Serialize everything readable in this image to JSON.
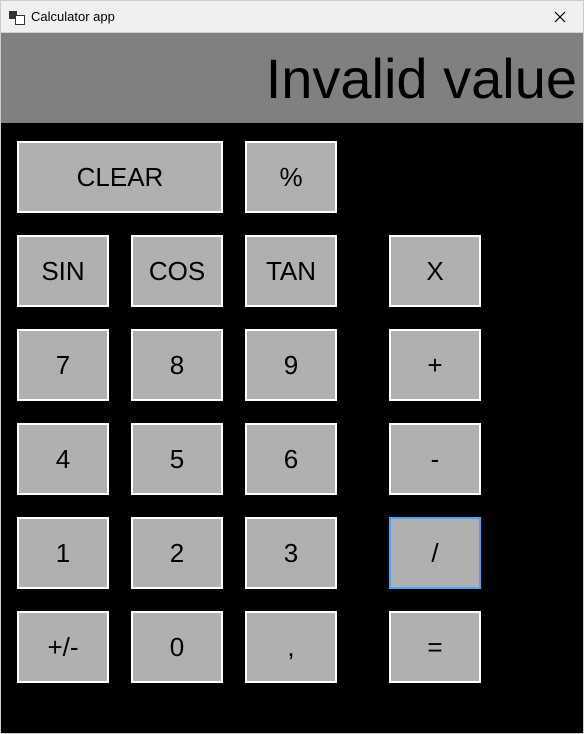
{
  "window": {
    "title": "Calculator app"
  },
  "display": {
    "value": "Invalid value"
  },
  "buttons": {
    "clear": "CLEAR",
    "percent": "%",
    "sin": "SIN",
    "cos": "COS",
    "tan": "TAN",
    "multiply": "X",
    "seven": "7",
    "eight": "8",
    "nine": "9",
    "plus": "+",
    "four": "4",
    "five": "5",
    "six": "6",
    "minus": "-",
    "one": "1",
    "two": "2",
    "three": "3",
    "divide": "/",
    "plusminus": "+/-",
    "zero": "0",
    "comma": ",",
    "equals": "="
  },
  "focused_button": "divide"
}
